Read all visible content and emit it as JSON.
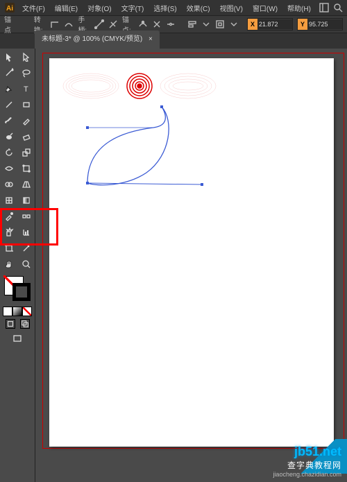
{
  "menu": {
    "items": [
      "文件(F)",
      "编辑(E)",
      "对象(O)",
      "文字(T)",
      "选择(S)",
      "效果(C)",
      "视图(V)",
      "窗口(W)",
      "帮助(H)"
    ]
  },
  "ctrl": {
    "label": "锚点",
    "convert": "转换:",
    "handle": "手柄:",
    "anchors": "锚点:",
    "x": {
      "tag": "X",
      "val": "21.872"
    },
    "y": {
      "tag": "Y",
      "val": "95.725"
    }
  },
  "tab": {
    "title": "未标题-3* @ 100% (CMYK/预览)"
  },
  "watermark": {
    "site": "jb51.net",
    "cn": "查字典教程网",
    "url": "jiaocheng.chazidian.com"
  }
}
